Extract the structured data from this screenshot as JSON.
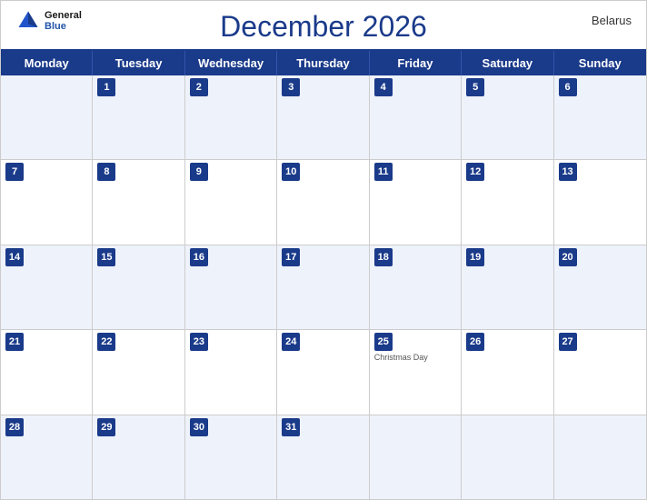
{
  "header": {
    "title": "December 2026",
    "country": "Belarus",
    "logo": {
      "general": "General",
      "blue": "Blue"
    }
  },
  "dayHeaders": [
    "Monday",
    "Tuesday",
    "Wednesday",
    "Thursday",
    "Friday",
    "Saturday",
    "Sunday"
  ],
  "weeks": [
    [
      {
        "day": "",
        "empty": true
      },
      {
        "day": "1"
      },
      {
        "day": "2"
      },
      {
        "day": "3"
      },
      {
        "day": "4"
      },
      {
        "day": "5"
      },
      {
        "day": "6"
      }
    ],
    [
      {
        "day": "7"
      },
      {
        "day": "8"
      },
      {
        "day": "9"
      },
      {
        "day": "10"
      },
      {
        "day": "11"
      },
      {
        "day": "12"
      },
      {
        "day": "13"
      }
    ],
    [
      {
        "day": "14"
      },
      {
        "day": "15"
      },
      {
        "day": "16"
      },
      {
        "day": "17"
      },
      {
        "day": "18"
      },
      {
        "day": "19"
      },
      {
        "day": "20"
      }
    ],
    [
      {
        "day": "21"
      },
      {
        "day": "22"
      },
      {
        "day": "23"
      },
      {
        "day": "24"
      },
      {
        "day": "25",
        "holiday": "Christmas Day"
      },
      {
        "day": "26"
      },
      {
        "day": "27"
      }
    ],
    [
      {
        "day": "28"
      },
      {
        "day": "29"
      },
      {
        "day": "30"
      },
      {
        "day": "31"
      },
      {
        "day": "",
        "empty": true
      },
      {
        "day": "",
        "empty": true
      },
      {
        "day": "",
        "empty": true
      }
    ]
  ]
}
